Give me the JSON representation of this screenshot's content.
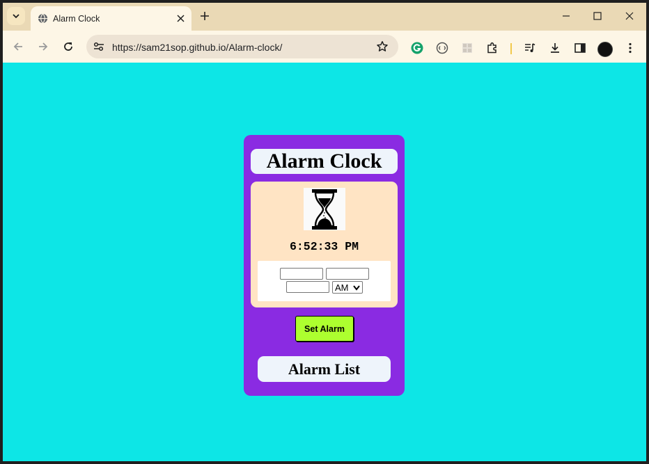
{
  "browser": {
    "tab_title": "Alarm Clock",
    "url": "https://sam21sop.github.io/Alarm-clock/"
  },
  "icons": {
    "tab_search": "chevron-down-icon",
    "favicon": "globe-icon",
    "tab_close": "close-icon",
    "new_tab": "plus-icon",
    "minimize": "minimize-icon",
    "maximize": "maximize-icon",
    "close_window": "close-icon",
    "back": "back-arrow-icon",
    "forward": "forward-arrow-icon",
    "reload": "reload-icon",
    "site_info": "tune-icon",
    "bookmark": "star-icon",
    "grammarly": "grammarly-icon",
    "extension_2": "circle-extension-icon",
    "extension_3": "grid-extension-icon",
    "extensions": "puzzle-icon",
    "media": "media-control-icon",
    "downloads": "download-icon",
    "side_panel": "side-panel-icon",
    "profile": "avatar",
    "menu": "kebab-menu-icon",
    "hourglass": "hourglass-icon"
  },
  "page": {
    "title": "Alarm Clock",
    "current_time": "6:52:33 PM",
    "form": {
      "hour_value": "",
      "minute_value": "",
      "second_value": "",
      "ampm_selected": "AM"
    },
    "set_alarm_label": "Set Alarm",
    "alarm_list_title": "Alarm List"
  },
  "colors": {
    "page_background": "#0de6e6",
    "card_background": "#8a2be2",
    "inner_background": "#ffe4c4",
    "button_background": "#adff2f",
    "browser_chrome": "#fdf6e6"
  }
}
